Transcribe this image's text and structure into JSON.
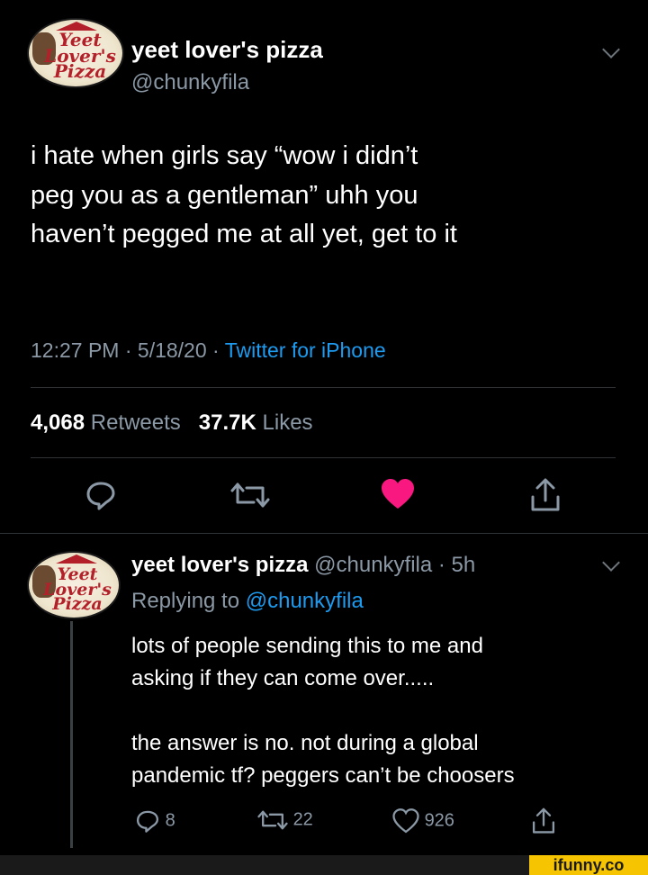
{
  "tweet": {
    "author": {
      "display_name": "yeet lover's pizza",
      "handle": "@chunkyfila",
      "avatar_text": "Yeet Lover's Pizza"
    },
    "text_lines": [
      "i hate when girls say “wow i didn’t",
      "peg you as a gentleman” uhh you",
      "haven’t pegged me at all yet, get to it"
    ],
    "meta": {
      "time": "12:27 PM",
      "sep1": "·",
      "date": "5/18/20",
      "sep2": "·",
      "source": "Twitter for iPhone"
    },
    "stats": {
      "retweets_count": "4,068",
      "retweets_label": "Retweets",
      "likes_count": "37.7K",
      "likes_label": "Likes"
    },
    "actions": {
      "reply_icon": "reply-icon",
      "retweet_icon": "retweet-icon",
      "like_icon": "heart-filled-icon",
      "share_icon": "share-icon",
      "liked_color": "#f91880"
    }
  },
  "reply": {
    "author": {
      "display_name": "yeet lover's pizza",
      "handle_time": "@chunkyfila · 5h"
    },
    "replying_prefix": "Replying to",
    "replying_to": "@chunkyfila",
    "text_lines": [
      "lots of people sending this to me and",
      "asking if they can come over.....",
      "the answer is no. not during a global",
      "pandemic tf? peggers can’t be choosers"
    ],
    "actions": {
      "reply_count": "8",
      "retweet_count": "22",
      "like_count": "926"
    }
  },
  "watermark": "ifunny.co",
  "colors": {
    "background": "#000000",
    "text": "#ffffff",
    "muted": "#8b98a5",
    "link": "#1d9bf0",
    "like": "#f91880",
    "watermark_bg": "#f6c400"
  }
}
